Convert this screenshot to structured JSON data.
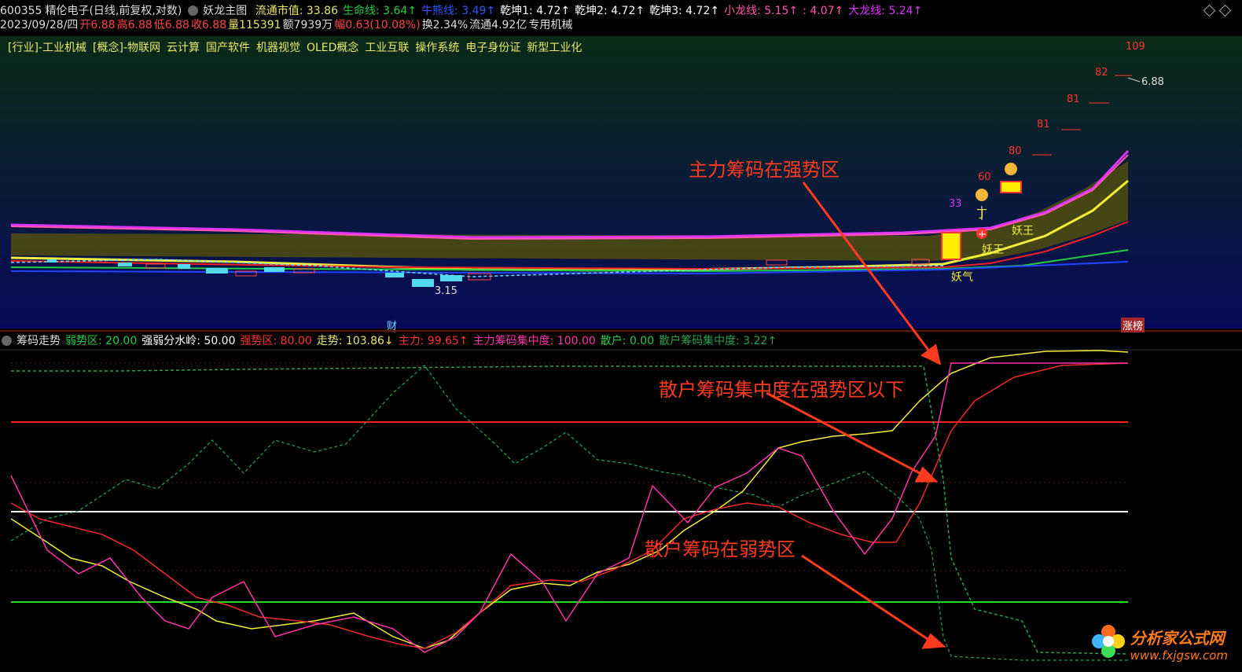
{
  "header": {
    "code": "600355",
    "name": "精伦电子",
    "period": "(日线,前复权,对数)",
    "indicator": "妖龙主图",
    "items": [
      {
        "label": "流通市值: 33.86",
        "color": "#e8e86a"
      },
      {
        "label": "生命线: 3.64↑",
        "color": "#22cc44"
      },
      {
        "label": "牛熊线: 3.49↑",
        "color": "#3355ff"
      },
      {
        "label": "乾坤1: 4.72↑",
        "color": "#ffffff"
      },
      {
        "label": "乾坤2: 4.72↑",
        "color": "#ffffff"
      },
      {
        "label": "乾坤3: 4.72↑",
        "color": "#ffffff"
      },
      {
        "label": "小龙线: 5.15↑",
        "color": "#ff55aa"
      },
      {
        "label": ": 4.07↑",
        "color": "#ff55aa"
      },
      {
        "label": "大龙线: 5.24↑",
        "color": "#dd33ff"
      }
    ]
  },
  "quote": {
    "date": "2023/09/28/四",
    "open": "开6.88",
    "high": "高6.88",
    "low": "低6.88",
    "close": "收6.88",
    "vol": "量115391",
    "amt": "额7939万",
    "amp": "幅0.63(10.08%)",
    "turnover": "换2.34%",
    "float": "流通4.92亿",
    "industry": "专用机械"
  },
  "tags": [
    "[行业]-工业机械",
    "[概念]-物联网",
    "云计算",
    "国产软件",
    "机器视觉",
    "OLED概念",
    "工业互联",
    "操作系统",
    "电子身份证",
    "新型工业化"
  ],
  "upper_labels": {
    "n109": "109",
    "n82": "82",
    "n81a": "81",
    "n81b": "81",
    "n80": "80",
    "n60": "60",
    "n33": "33",
    "price_high": "6.88",
    "price_low": "3.15",
    "yaoqi": "妖气",
    "yaowang1": "妖王",
    "yaowang2": "妖王",
    "ding": "丁",
    "cai": "财",
    "zhangbang": "涨榜"
  },
  "lower_header": {
    "name": "筹码走势",
    "items": [
      {
        "label": "弱势区: 20.00",
        "color": "#22cc44"
      },
      {
        "label": "强弱分水岭: 50.00",
        "color": "#ffffff"
      },
      {
        "label": "强势区: 80.00",
        "color": "#ff3333"
      },
      {
        "label": "走势: 103.86↓",
        "color": "#e8e86a"
      },
      {
        "label": "主力: 99.65↑",
        "color": "#ff3333"
      },
      {
        "label": "主力筹码集中度: 100.00",
        "color": "#ff33aa"
      },
      {
        "label": "散户: 0.00",
        "color": "#22cc44"
      },
      {
        "label": "散户筹码集中度: 3.22↑",
        "color": "#2aa14e"
      }
    ]
  },
  "annotations": {
    "a1": "主力筹码在强势区",
    "a2": "散户筹码集中度在强势区以下",
    "a3": "散户筹码在弱势区"
  },
  "watermark": {
    "title": "分析家公式网",
    "url": "www.fxjgsw.com"
  },
  "colors": {
    "annotation": "#ff3b1f",
    "strong": "#ff2020",
    "weak": "#22dd22",
    "divider": "#ffffff"
  }
}
